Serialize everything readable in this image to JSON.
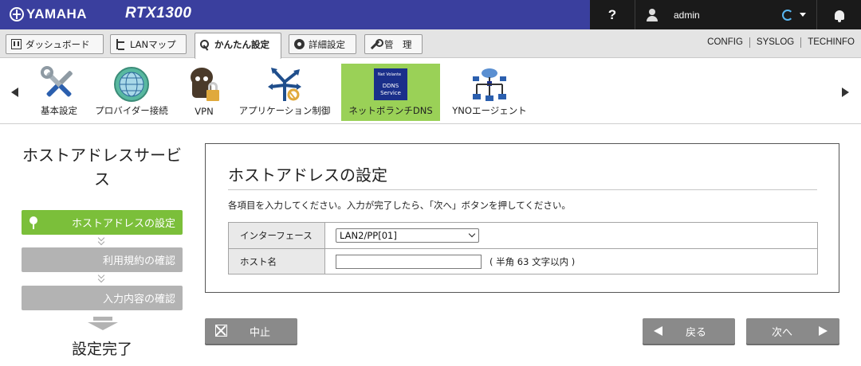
{
  "header": {
    "brand": "YAMAHA",
    "model": "RTX1300",
    "help": "?",
    "user": "admin"
  },
  "tabs": [
    {
      "label": "ダッシュボード",
      "icon": "dashboard-icon"
    },
    {
      "label": "LANマップ",
      "icon": "lan-map-icon"
    },
    {
      "label": "かんたん設定",
      "icon": "key-icon",
      "active": true
    },
    {
      "label": "詳細設定",
      "icon": "gear-icon"
    },
    {
      "label": "管　理",
      "icon": "wrench-icon"
    }
  ],
  "top_links": [
    "CONFIG",
    "SYSLOG",
    "TECHINFO"
  ],
  "iconbar": [
    {
      "label": "基本設定",
      "icon": "tools-icon"
    },
    {
      "label": "プロバイダー接続",
      "icon": "globe-icon"
    },
    {
      "label": "VPN",
      "icon": "vpn-lock-icon"
    },
    {
      "label": "アプリケーション制御",
      "icon": "app-control-icon"
    },
    {
      "label": "ネットボランチDNS",
      "icon": "ddns-icon",
      "active": true
    },
    {
      "label": "YNOエージェント",
      "icon": "network-icon"
    }
  ],
  "ddns_icon_text": {
    "line1": "Net Volante",
    "line2": "DDNS",
    "line3": "Service"
  },
  "left": {
    "title": "ホストアドレスサービス",
    "steps": [
      {
        "label": "ホストアドレスの設定",
        "state": "current"
      },
      {
        "label": "利用規約の確認",
        "state": "pending"
      },
      {
        "label": "入力内容の確認",
        "state": "pending"
      }
    ],
    "done_label": "設定完了"
  },
  "main": {
    "title": "ホストアドレスの設定",
    "instructions": "各項目を入力してください。入力が完了したら、「次へ」ボタンを押してください。",
    "fields": {
      "interface": {
        "label": "インターフェース",
        "value": "LAN2/PP[01]"
      },
      "hostname": {
        "label": "ホスト名",
        "value": "",
        "hint": "( 半角 63 文字以内 )"
      }
    }
  },
  "buttons": {
    "cancel": "中止",
    "back": "戻る",
    "next": "次へ"
  },
  "colors": {
    "header_bg": "#3a3f9e",
    "header_dark": "#1a1a1a",
    "accent_green": "#7bbf3a",
    "active_icon_bg": "#9ad157",
    "button_gray": "#8a8a8a"
  }
}
